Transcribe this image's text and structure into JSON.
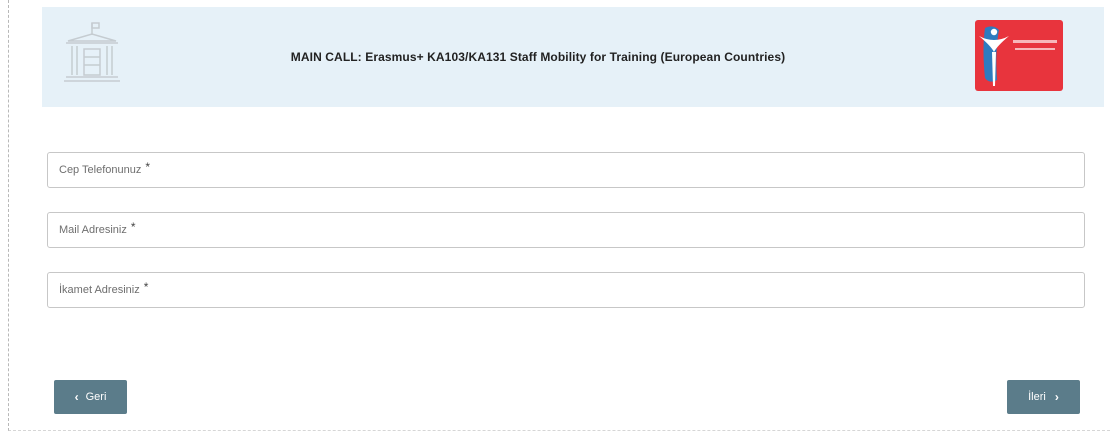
{
  "header": {
    "title": "MAIN CALL: Erasmus+ KA103/KA131 Staff Mobility for Training (European Countries)",
    "institution_icon": "building-icon",
    "logo_icon": "university-logo"
  },
  "form": {
    "fields": [
      {
        "label": "Cep Telefonunuz",
        "required_mark": "*"
      },
      {
        "label": "Mail Adresiniz",
        "required_mark": "*"
      },
      {
        "label": "İkamet Adresiniz",
        "required_mark": "*"
      }
    ]
  },
  "nav": {
    "back_label": "Geri",
    "back_icon": "chevron-left-icon",
    "next_label": "İleri",
    "next_icon": "chevron-right-icon"
  },
  "colors": {
    "header_bg": "#e6f1f8",
    "button_bg": "#5b7c8a",
    "logo_red": "#e8343d",
    "logo_blue": "#2e7bbf"
  }
}
